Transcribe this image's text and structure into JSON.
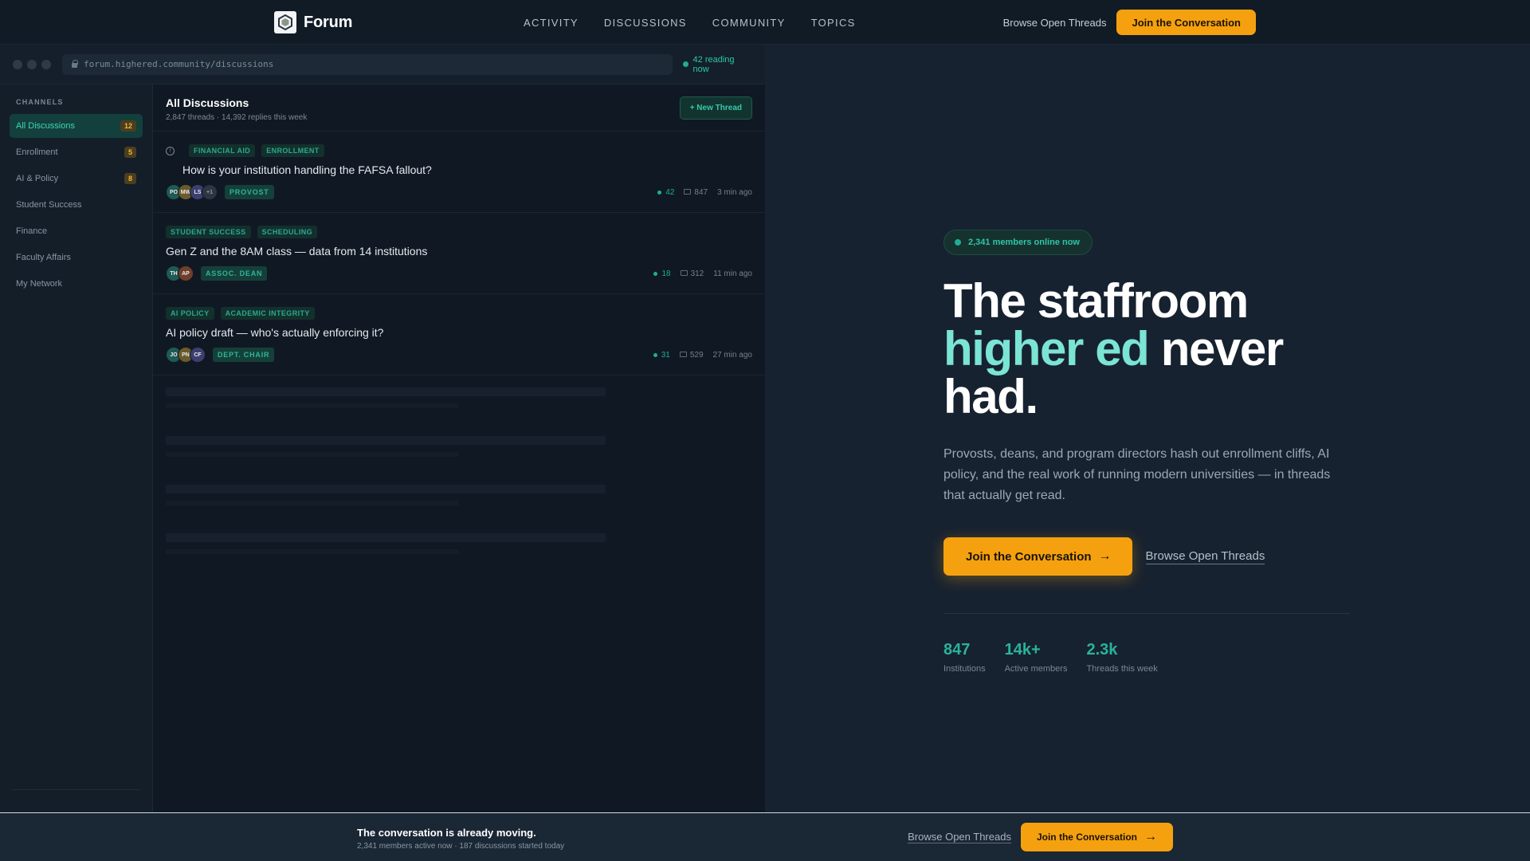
{
  "nav": {
    "brand": "Forum",
    "links": [
      "ACTIVITY",
      "DISCUSSIONS",
      "COMMUNITY",
      "TOPICS"
    ],
    "browse": "Browse Open Threads",
    "join": "Join the Conversation"
  },
  "browser": {
    "url": "forum.highered.community/discussions",
    "reading_now": "42 reading now"
  },
  "sidebar": {
    "label": "CHANNELS",
    "items": [
      {
        "label": "All Discussions",
        "badge": "12",
        "active": true
      },
      {
        "label": "Enrollment",
        "badge": "5"
      },
      {
        "label": "AI & Policy",
        "badge": "8"
      },
      {
        "label": "Student Success",
        "badge": ""
      },
      {
        "label": "Finance",
        "badge": ""
      },
      {
        "label": "Faculty Affairs",
        "badge": ""
      },
      {
        "label": "My Network",
        "badge": ""
      }
    ]
  },
  "main": {
    "title": "All Discussions",
    "subtitle": "2,847 threads · 14,392 replies this week",
    "new_thread": "+ New Thread"
  },
  "threads": [
    {
      "tags": [
        "FINANCIAL AID",
        "ENROLLMENT"
      ],
      "title": "How is your institution handling the FAFSA fallout?",
      "avatars": [
        "PO",
        "MW",
        "LS",
        "+1"
      ],
      "role": "PROVOST",
      "live": "42",
      "replies": "847",
      "time": "3 min ago"
    },
    {
      "tags": [
        "STUDENT SUCCESS",
        "SCHEDULING"
      ],
      "title": "Gen Z and the 8AM class — data from 14 institutions",
      "avatars": [
        "TH",
        "AP"
      ],
      "role": "ASSOC. DEAN",
      "live": "18",
      "replies": "312",
      "time": "11 min ago"
    },
    {
      "tags": [
        "AI POLICY",
        "ACADEMIC INTEGRITY"
      ],
      "title": "AI policy draft — who's actually enforcing it?",
      "avatars": [
        "JO",
        "PN",
        "CF"
      ],
      "role": "DEPT. CHAIR",
      "live": "31",
      "replies": "529",
      "time": "27 min ago"
    }
  ],
  "hero": {
    "online": "2,341 members online now",
    "title_line1": "The staffroom",
    "title_accent": "higher ed",
    "title_rest": " never",
    "title_line3": "had.",
    "description": "Provosts, deans, and program directors hash out enrollment cliffs, AI policy, and the real work of running modern universities — in threads that actually get read.",
    "join": "Join the Conversation",
    "browse": "Browse Open Threads",
    "stats": [
      {
        "value": "847",
        "label": "Institutions"
      },
      {
        "value": "14k+",
        "label": "Active members"
      },
      {
        "value": "2.3k",
        "label": "Threads this week"
      }
    ]
  },
  "bottom": {
    "title": "The conversation is already moving.",
    "subtitle": "2,341 members active now · 187 discussions started today",
    "browse": "Browse Open Threads",
    "join": "Join the Conversation"
  },
  "colors": {
    "accent_amber": "#f5a10f",
    "accent_teal": "#2ab39a",
    "accent_mint": "#7be4d4",
    "background": "#172230"
  }
}
